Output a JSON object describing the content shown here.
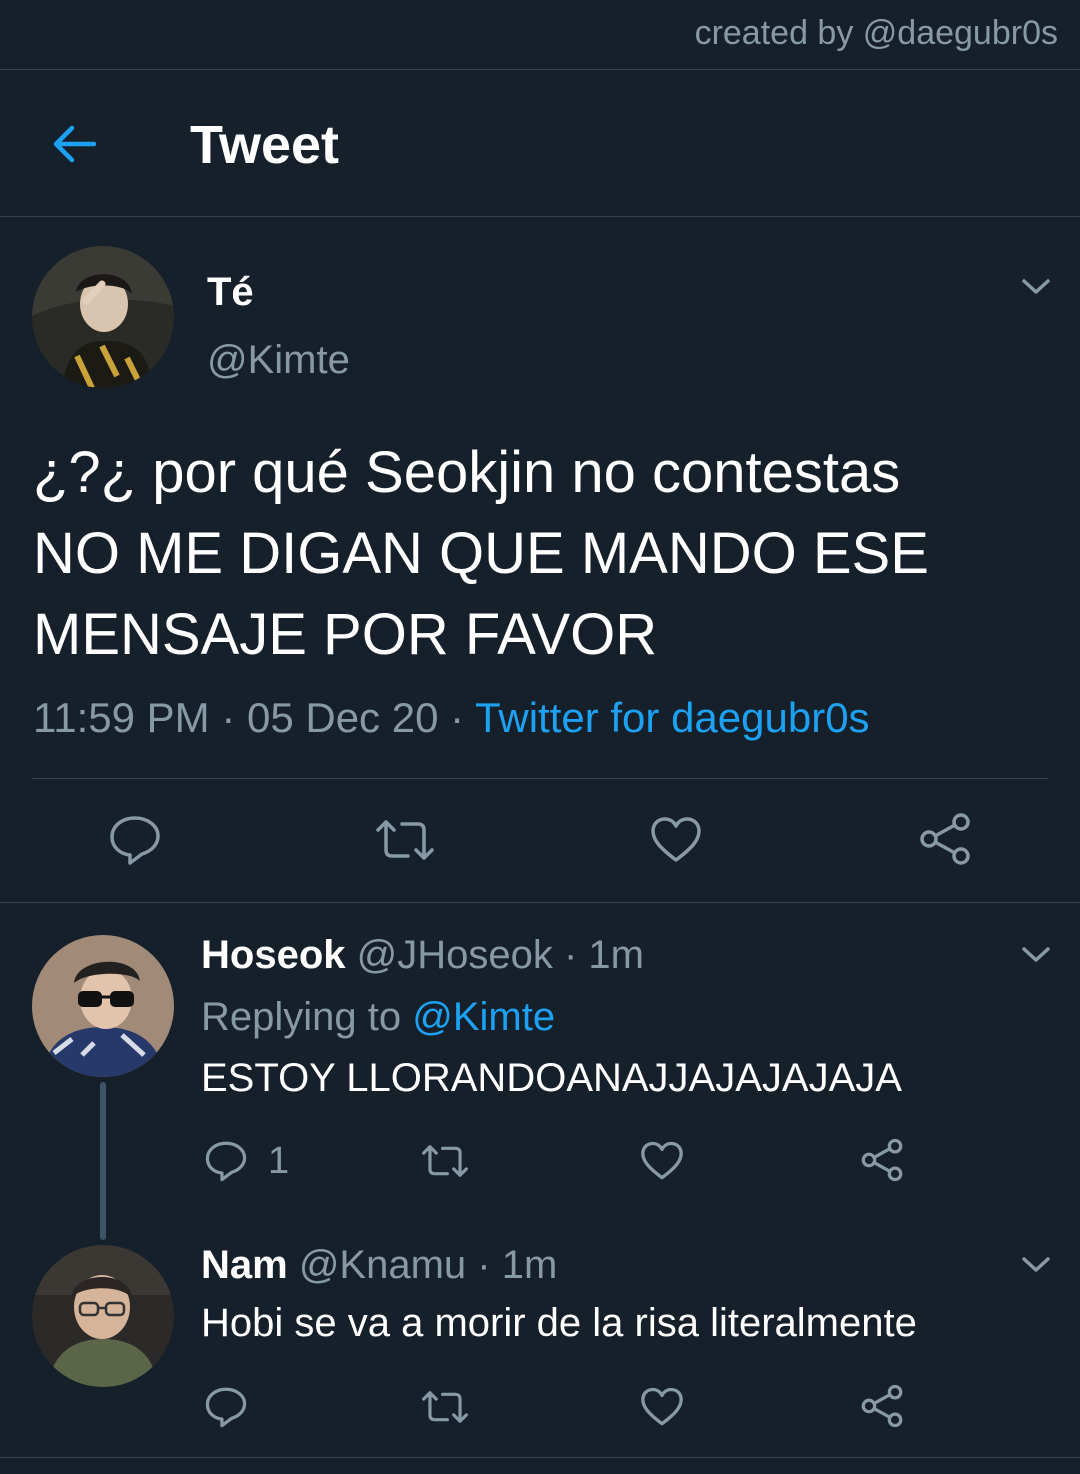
{
  "watermark": "created by @daegubr0s",
  "header": {
    "title": "Tweet",
    "back_icon": "arrow-left-icon"
  },
  "main_tweet": {
    "name": "Té",
    "handle": "@Kimte",
    "lines": [
      "¿?¿ por qué Seokjin no contestas",
      "NO ME DIGAN QUE MANDO ESE",
      "MENSAJE POR FAVOR"
    ],
    "time": "11:59 PM",
    "sep": " · ",
    "date": "05 Dec 20",
    "source": "Twitter for daegubr0s"
  },
  "replies": [
    {
      "name": "Hoseok",
      "handle": "@JHoseok",
      "dot": " · ",
      "time": "1m",
      "replying_prefix": "Replying to ",
      "replying_to": "@Kimte",
      "text": "ESTOY LLORANDOANAJJAJAJAJAJA",
      "reply_count": "1"
    },
    {
      "name": "Nam",
      "handle": "@Knamu",
      "dot": " · ",
      "time": "1m",
      "text": "Hobi se va a morir de la risa literalmente"
    }
  ],
  "colors": {
    "background": "#15202b",
    "accent": "#1da1f2",
    "muted": "#8899a6",
    "divider": "#38444d"
  }
}
